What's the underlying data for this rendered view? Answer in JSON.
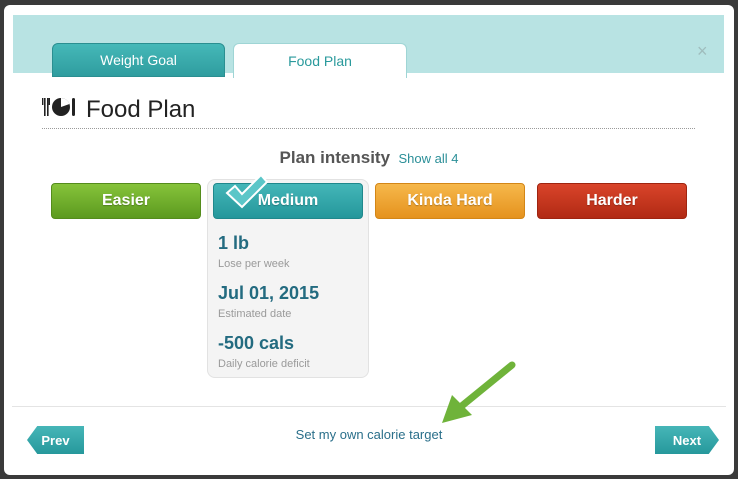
{
  "tabs": [
    {
      "label": "Weight Goal"
    },
    {
      "label": "Food Plan"
    }
  ],
  "header": {
    "title": "Food Plan",
    "icon": "fork-plate-knife-icon"
  },
  "close_icon": "×",
  "intensity": {
    "label": "Plan intensity",
    "show_all": "Show all 4",
    "options": [
      "Easier",
      "Medium",
      "Kinda Hard",
      "Harder"
    ],
    "selected": "Medium"
  },
  "plan": {
    "rate_value": "1 lb",
    "rate_label": "Lose per week",
    "date_value": "Jul 01, 2015",
    "date_label": "Estimated date",
    "deficit_value": "-500 cals",
    "deficit_label": "Daily calorie deficit"
  },
  "footer": {
    "prev": "Prev",
    "next": "Next",
    "own_target": "Set my own calorie target"
  },
  "colors": {
    "teal": "#2f9d9f",
    "green": "#6aad28",
    "orange": "#eea431",
    "red": "#c2351c"
  }
}
